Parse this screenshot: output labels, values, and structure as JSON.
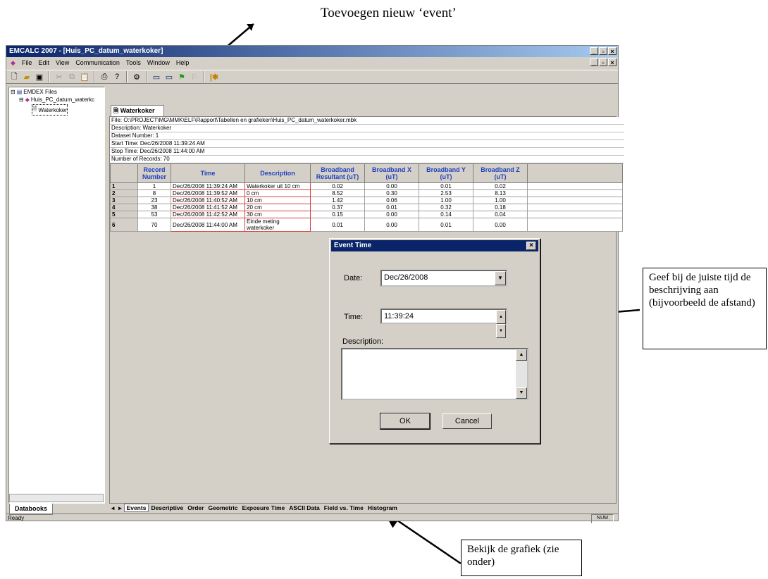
{
  "annotations": {
    "top": "Toevoegen nieuw ‘event’",
    "right": "Geef bij de juiste tijd de beschrijving aan (bijvoorbeeld de afstand)",
    "bottom": "Bekijk de grafiek (zie onder)"
  },
  "window": {
    "title": "EMCALC 2007 - [Huis_PC_datum_waterkoker]",
    "menu": [
      "File",
      "Edit",
      "View",
      "Communication",
      "Tools",
      "Window",
      "Help"
    ]
  },
  "tree": {
    "root": "EMDEX Files",
    "child": "Huis_PC_datum_waterkc",
    "leaf": "Waterkoker",
    "tab": "Databooks"
  },
  "document": {
    "tab": "Waterkoker",
    "info": [
      "File: O:\\PROJECT\\MG\\MMK\\ELF\\Rapport\\Tabellen en grafieken\\Huis_PC_datum_waterkoker.mbk",
      "Description: Waterkoker",
      "Dataset Number: 1",
      "Start Time: Dec/26/2008 11:39:24 AM",
      "Stop Time: Dec/26/2008 11:44:00 AM",
      "Number of Records: 70"
    ],
    "columns": [
      "Record Number",
      "Time",
      "Description",
      "Broadband Resultant (uT)",
      "Broadband X (uT)",
      "Broadband Y (uT)",
      "Broadband Z (uT)"
    ],
    "rows": [
      [
        "1",
        "1",
        "Dec/26/2008 11:39:24 AM",
        "Waterkoker uit 10 cm",
        "0.02",
        "0.00",
        "0.01",
        "0.02"
      ],
      [
        "2",
        "8",
        "Dec/26/2008 11:39:52 AM",
        "0 cm",
        "8.52",
        "0.30",
        "2.53",
        "8.13"
      ],
      [
        "3",
        "23",
        "Dec/26/2008 11:40:52 AM",
        "10 cm",
        "1.42",
        "0.06",
        "1.00",
        "1.00"
      ],
      [
        "4",
        "38",
        "Dec/26/2008 11:41:52 AM",
        "20 cm",
        "0.37",
        "0.01",
        "0.32",
        "0.18"
      ],
      [
        "5",
        "53",
        "Dec/26/2008 11:42:52 AM",
        "30 cm",
        "0.15",
        "0.00",
        "0.14",
        "0.04"
      ],
      [
        "6",
        "70",
        "Dec/26/2008 11:44:00 AM",
        "Einde meting waterkoker",
        "0.01",
        "0.00",
        "0.01",
        "0.00"
      ]
    ],
    "sheet_tabs": [
      "Events",
      "Descriptive",
      "Order",
      "Geometric",
      "Exposure Time",
      "ASCII Data",
      "Field vs. Time",
      "Histogram"
    ]
  },
  "status": {
    "left": "Ready",
    "num": "NUM"
  },
  "dialog": {
    "title": "Event Time",
    "date_label": "Date:",
    "date_value": "Dec/26/2008",
    "time_label": "Time:",
    "time_value": "11:39:24",
    "description_label": "Description:",
    "ok": "OK",
    "cancel": "Cancel"
  }
}
